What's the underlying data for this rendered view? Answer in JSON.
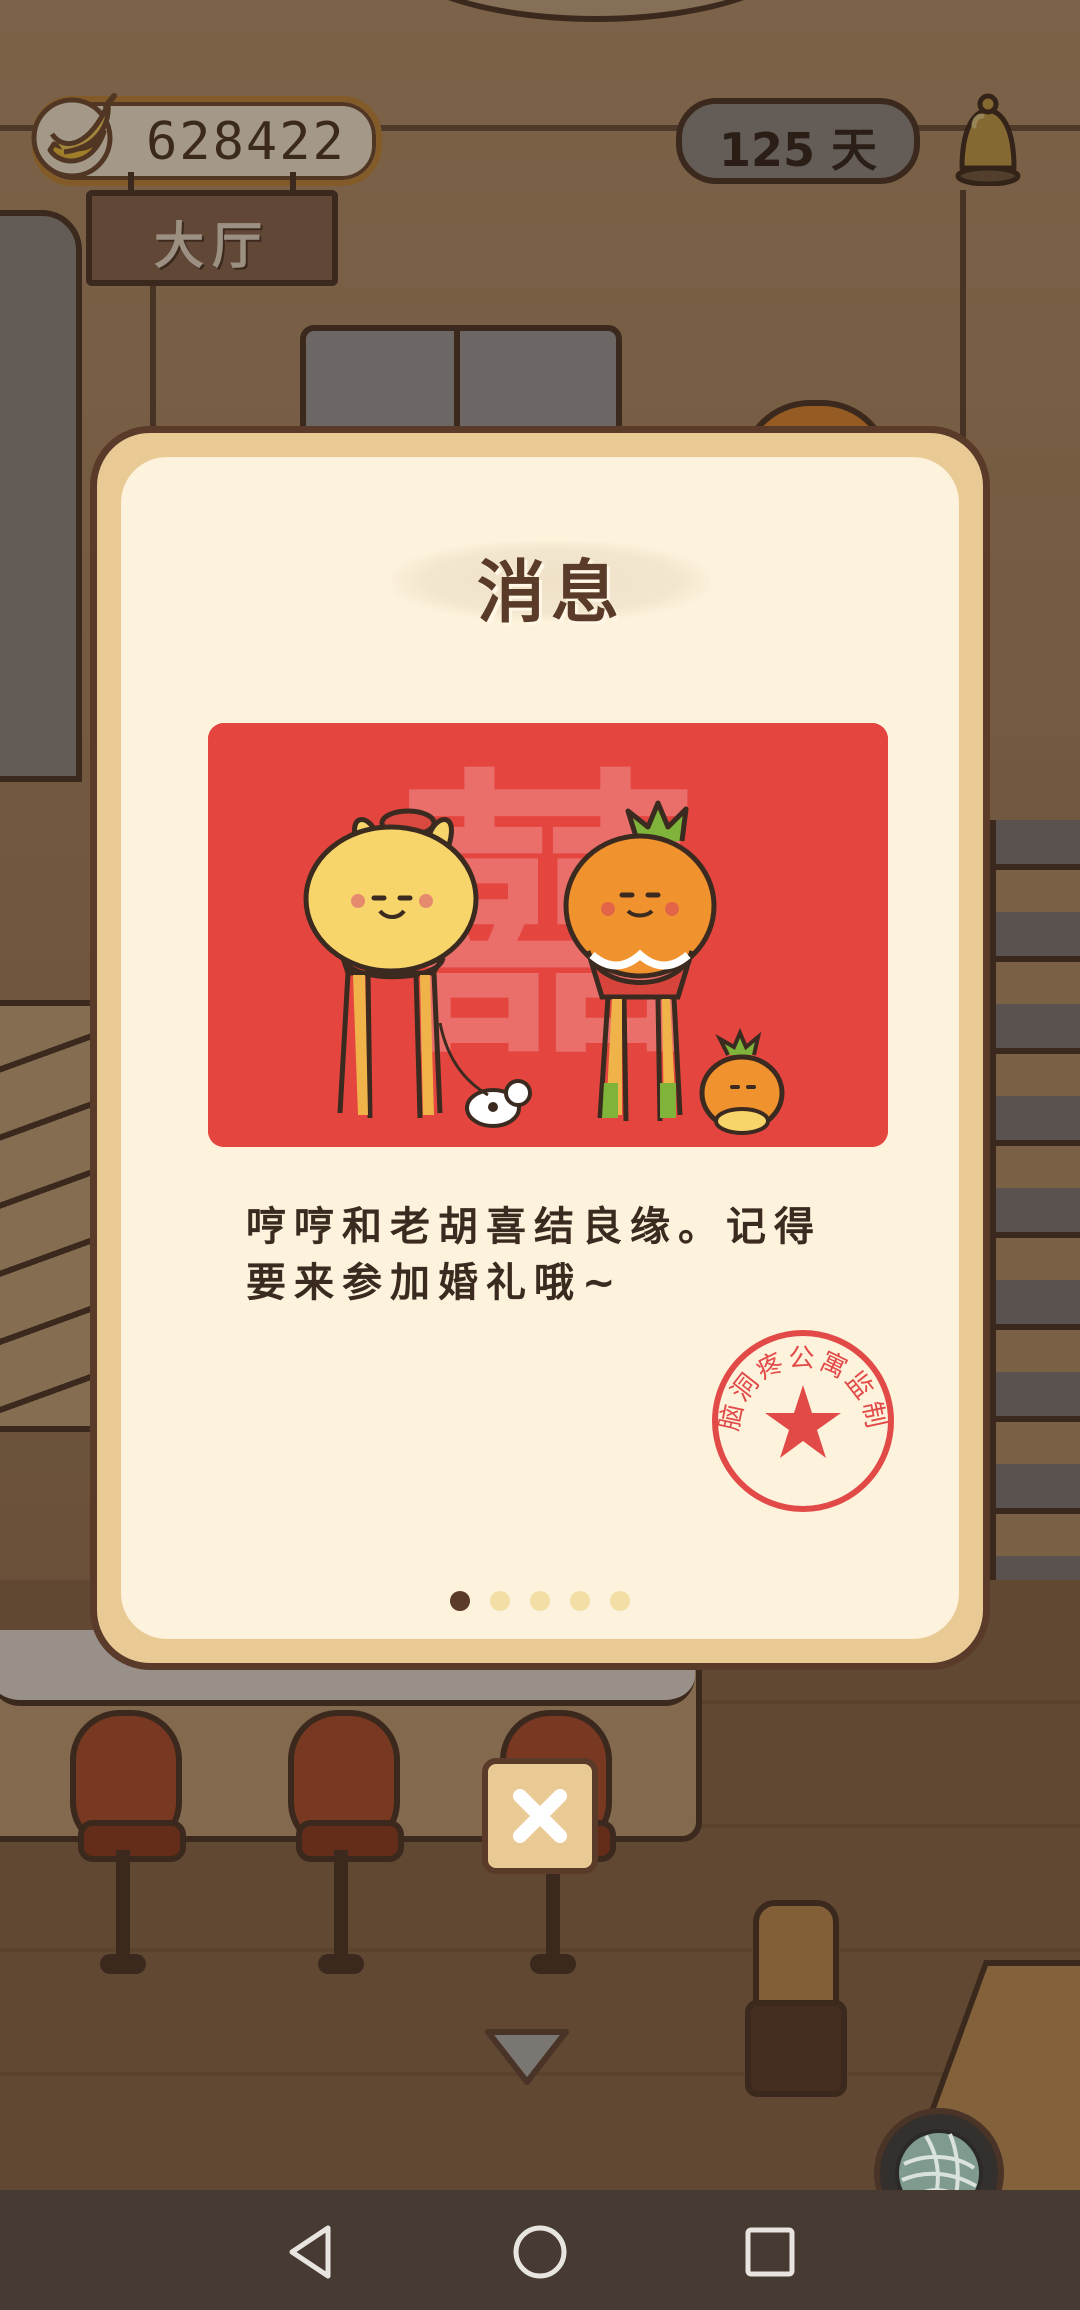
{
  "hud": {
    "banana_count": "628422",
    "room_name": "大厅",
    "days": "125 天"
  },
  "dialog": {
    "title": "消息",
    "illustration_glyph": "囍",
    "message": "哼哼和老胡喜结良缘。记得要来参加婚礼哦~",
    "stamp_text": "脑洞疼公寓监制",
    "page_count": 5,
    "current_page": 1
  },
  "icons": {
    "banana": "banana-icon",
    "bell": "bell-icon",
    "close": "close-icon",
    "collapse": "chevron-down-icon",
    "yarn": "yarn-ball-icon",
    "nav_back": "triangle-back-icon",
    "nav_home": "circle-home-icon",
    "nav_recents": "square-recents-icon"
  },
  "colors": {
    "dialog_frame": "#e9ca95",
    "dialog_paper": "#fdf2dc",
    "illustration_red": "#e4463f",
    "stamp_red": "#e24a48",
    "dark_brown": "#5a3a28"
  }
}
